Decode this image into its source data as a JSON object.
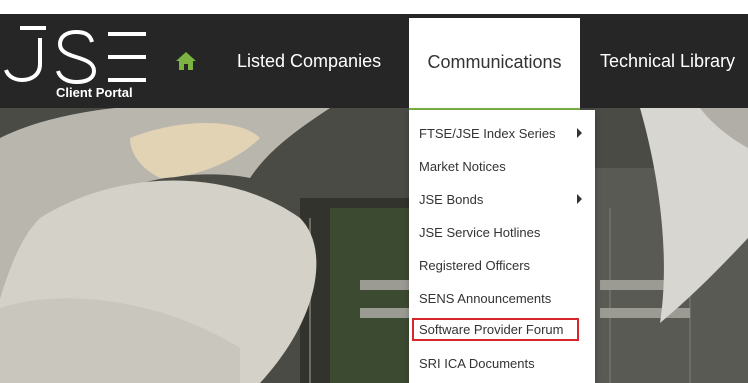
{
  "brand": {
    "logo_text": "JSE",
    "caption": "Client Portal"
  },
  "nav": {
    "home_icon": "home-icon",
    "items": [
      {
        "label": "Listed Companies"
      },
      {
        "label": "Communications",
        "active": true
      },
      {
        "label": "Technical Library"
      }
    ]
  },
  "dropdown": {
    "items": [
      {
        "label": "FTSE/JSE Index Series",
        "submenu": true
      },
      {
        "label": "Market Notices",
        "submenu": false
      },
      {
        "label": "JSE Bonds",
        "submenu": true
      },
      {
        "label": "JSE Service Hotlines",
        "submenu": false
      },
      {
        "label": "Registered Officers",
        "submenu": false
      },
      {
        "label": "SENS Announcements",
        "submenu": false
      },
      {
        "label": "Software Provider Forum",
        "submenu": false,
        "highlighted": true
      },
      {
        "label": "SRI ICA Documents",
        "submenu": false
      }
    ]
  },
  "colors": {
    "navbar_bg": "#262626",
    "accent_green": "#7cb342",
    "highlight_red": "#d9262c",
    "text_dark": "#333333"
  }
}
